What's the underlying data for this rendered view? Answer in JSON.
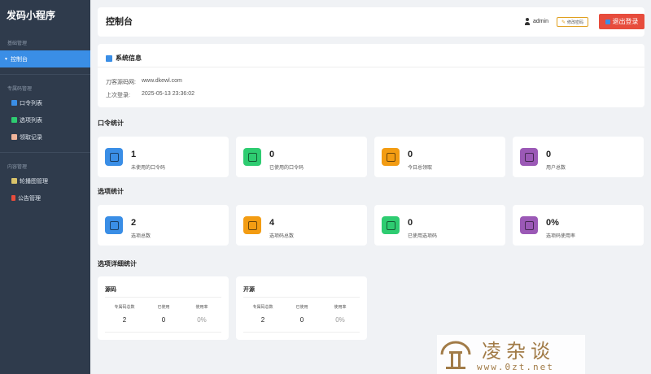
{
  "sidebar": {
    "brand": "发码小程序",
    "groups": [
      {
        "title": "基础管理",
        "items": [
          {
            "label": "控制台",
            "caret": "▼"
          }
        ]
      },
      {
        "title": "专属码管理",
        "items": [
          {
            "label": "口令列表"
          },
          {
            "label": "选项列表"
          },
          {
            "label": "领取记录"
          }
        ]
      },
      {
        "title": "内容管理",
        "items": [
          {
            "label": "轮播图管理"
          },
          {
            "label": "公告管理"
          }
        ]
      }
    ]
  },
  "header": {
    "title": "控制台",
    "username": "admin",
    "change_password": "修改密码",
    "logout": "退出登录"
  },
  "system_info": {
    "title": "系统信息",
    "rows": [
      {
        "key": "刀客源码网:",
        "value": "www.dkewl.com"
      },
      {
        "key": "上次登录:",
        "value": "2025-05-13 23:36:02"
      }
    ]
  },
  "code_stats": {
    "title": "口令统计",
    "cards": [
      {
        "value": "1",
        "label": "未使用的口令码",
        "color": "#3a8ee6"
      },
      {
        "value": "0",
        "label": "已使用的口令码",
        "color": "#2ecc71"
      },
      {
        "value": "0",
        "label": "今日总领取",
        "color": "#f39c12"
      },
      {
        "value": "0",
        "label": "用户总数",
        "color": "#9b59b6"
      }
    ]
  },
  "option_stats": {
    "title": "选项统计",
    "cards": [
      {
        "value": "2",
        "label": "选项总数",
        "color": "#3a8ee6"
      },
      {
        "value": "4",
        "label": "选项码总数",
        "color": "#f39c12"
      },
      {
        "value": "0",
        "label": "已使用选项码",
        "color": "#2ecc71"
      },
      {
        "value": "0%",
        "label": "选项码使用率",
        "color": "#9b59b6"
      }
    ]
  },
  "option_detail": {
    "title": "选项详细统计",
    "columns": [
      "专属码总数",
      "已使用",
      "使用率"
    ],
    "items": [
      {
        "name": "源码",
        "total": "2",
        "used": "0",
        "rate": "0%"
      },
      {
        "name": "开源",
        "total": "2",
        "used": "0",
        "rate": "0%"
      }
    ]
  },
  "watermark": {
    "text": "凌杂谈",
    "url": "www.0zt.net"
  }
}
